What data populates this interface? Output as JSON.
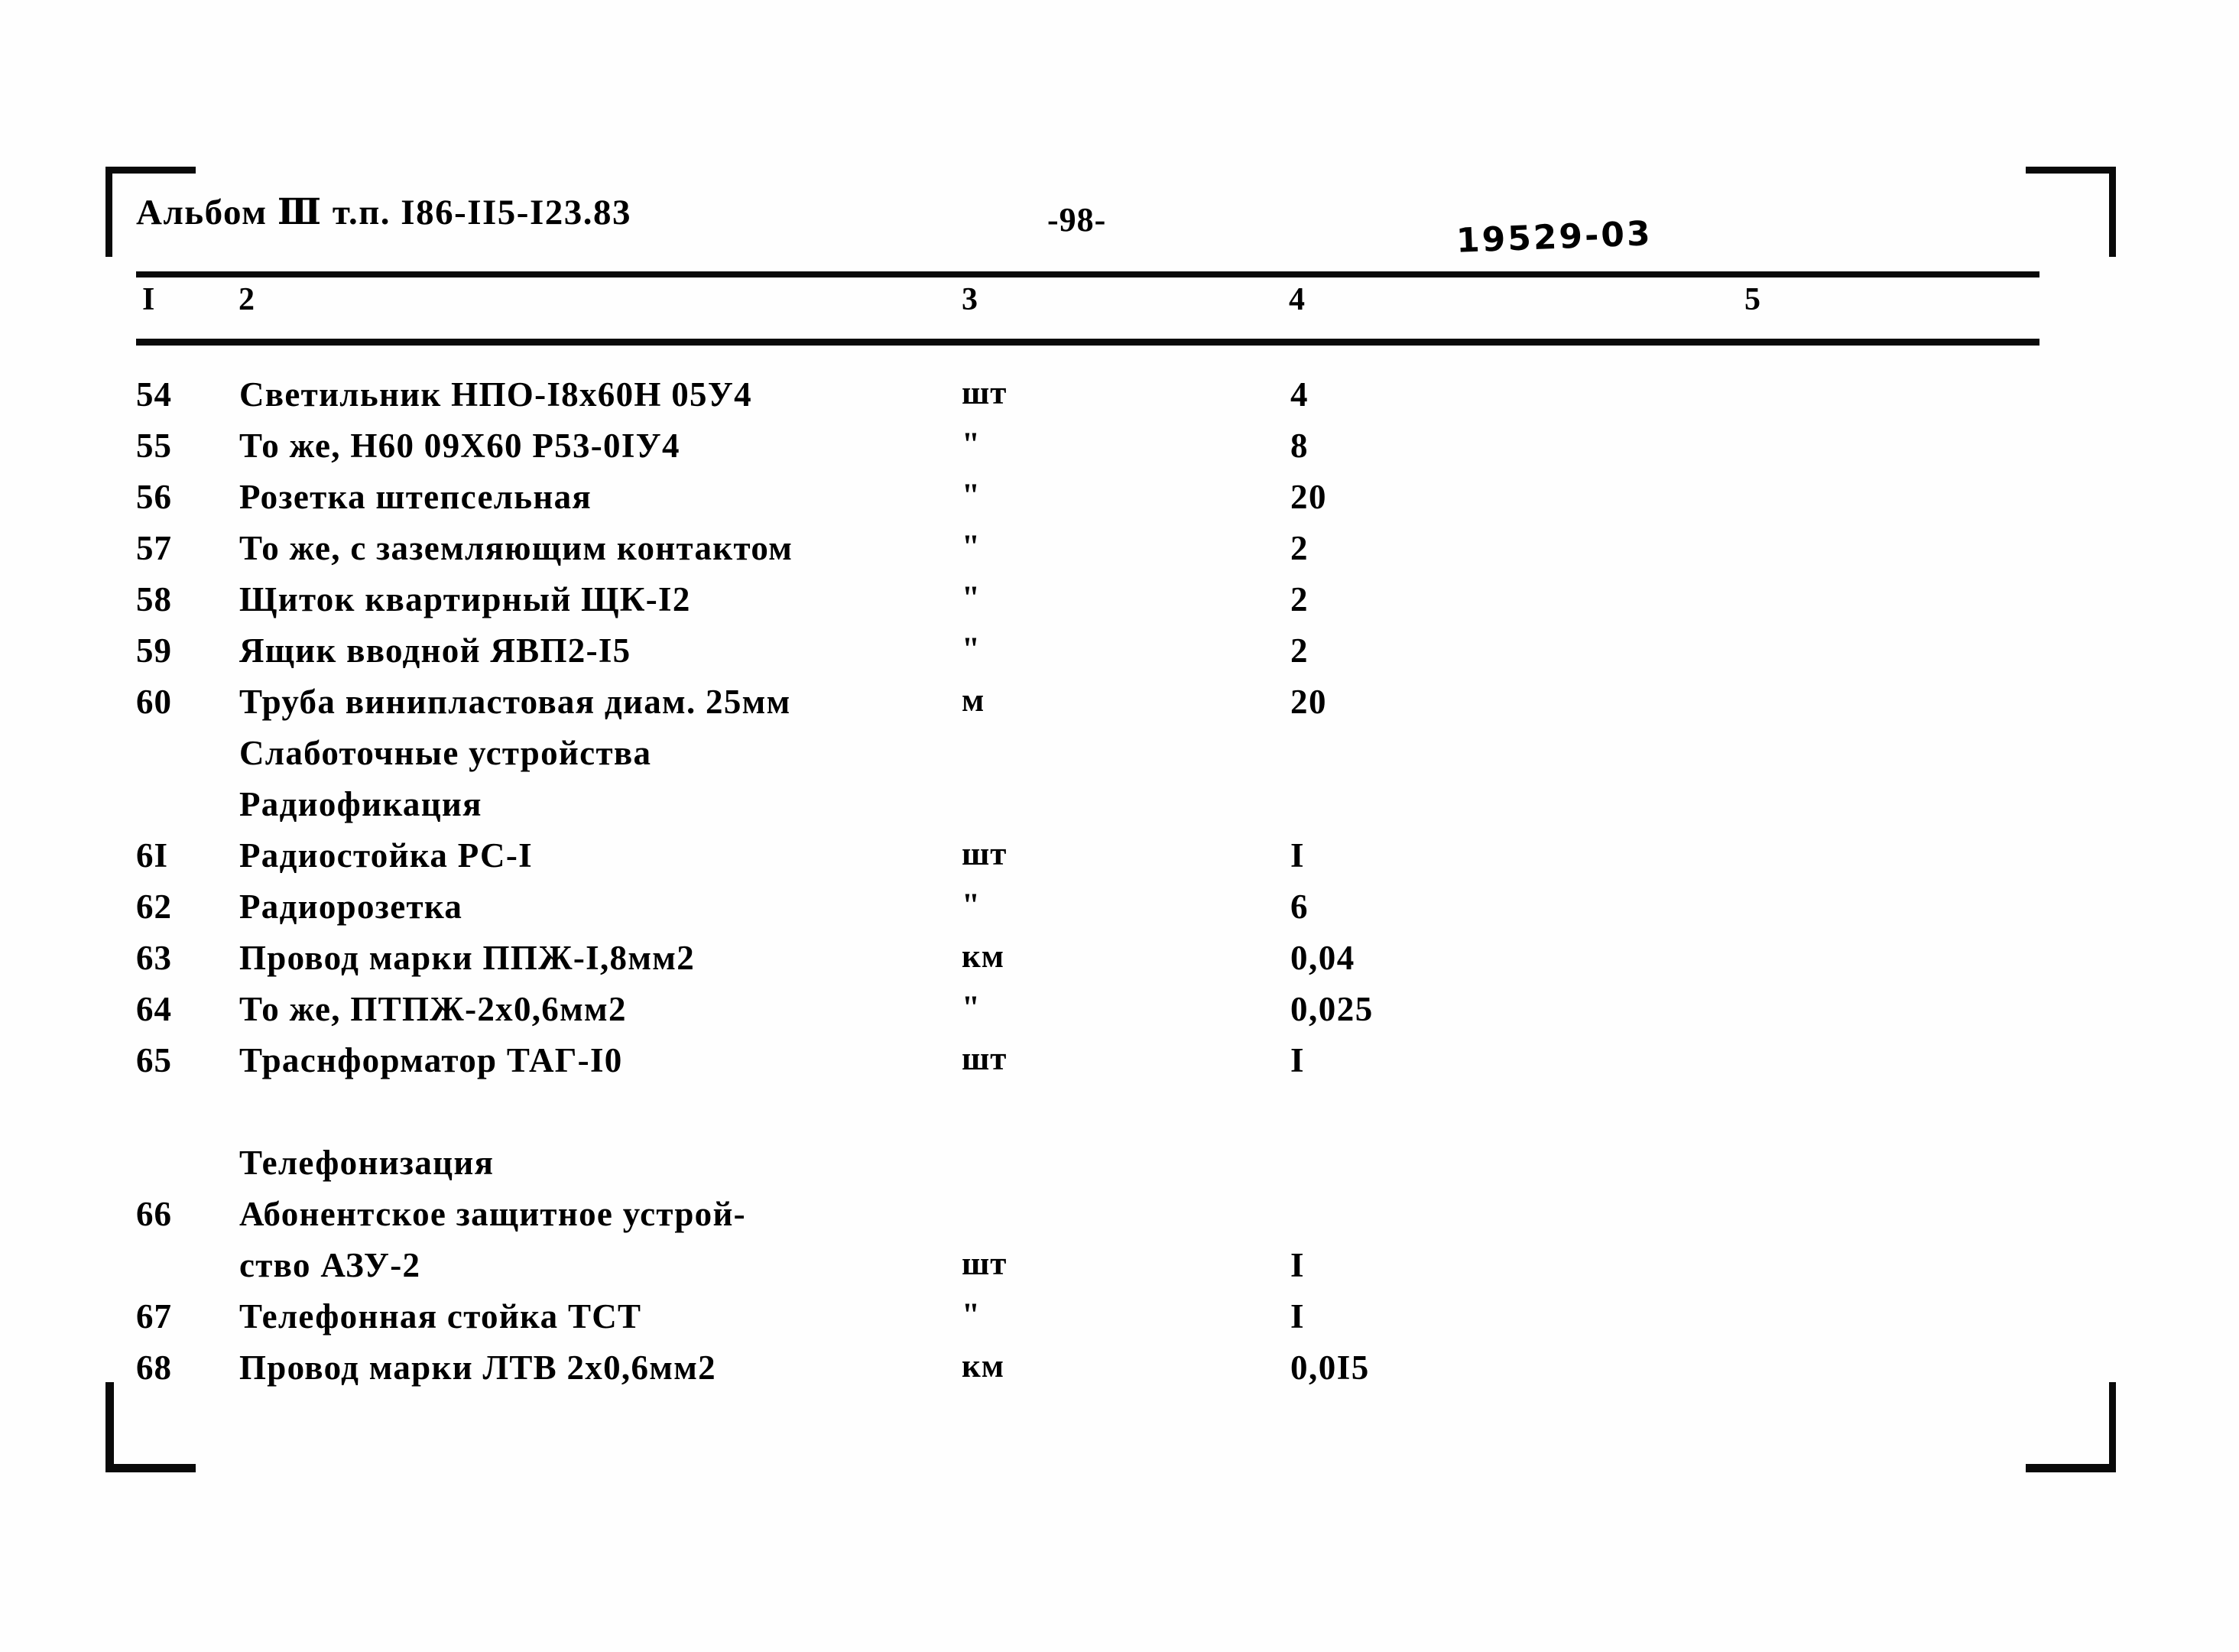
{
  "header": {
    "album_title": "Альбом Ⅲ т.п. I86-II5-I23.83",
    "page_number": "-98-",
    "doc_stamp": "19529-03"
  },
  "table": {
    "column_numbers": [
      "I",
      "2",
      "3",
      "4",
      "5"
    ],
    "rows": [
      {
        "no": "54",
        "name": "Светильник НПО-I8х60Н 05У4",
        "unit": "шт",
        "qty": "4",
        "note": ""
      },
      {
        "no": "55",
        "name": "То же, Н60 09Х60 Р53-0IУ4",
        "unit": "\"",
        "qty": "8",
        "note": ""
      },
      {
        "no": "56",
        "name": "Розетка штепсельная",
        "unit": "\"",
        "qty": "20",
        "note": ""
      },
      {
        "no": "57",
        "name": "То же, с заземляющим  контактом",
        "unit": "\"",
        "qty": "2",
        "note": ""
      },
      {
        "no": "58",
        "name": "Щиток квартирный ЩК-I2",
        "unit": "\"",
        "qty": "2",
        "note": ""
      },
      {
        "no": "59",
        "name": "Ящик вводной ЯВП2-I5",
        "unit": "\"",
        "qty": "2",
        "note": ""
      },
      {
        "no": "60",
        "name": "Труба винипластовая диам. 25мм",
        "unit": "м",
        "qty": "20",
        "note": ""
      },
      {
        "no": "",
        "name": "Слаботочные устройства",
        "unit": "",
        "qty": "",
        "note": "",
        "kind": "section"
      },
      {
        "no": "",
        "name": "Радиофикация",
        "unit": "",
        "qty": "",
        "note": "",
        "kind": "section"
      },
      {
        "no": "6I",
        "name": "Радиостойка РС-I",
        "unit": "шт",
        "qty": "I",
        "note": ""
      },
      {
        "no": "62",
        "name": "Радиорозетка",
        "unit": "\"",
        "qty": "6",
        "note": ""
      },
      {
        "no": "63",
        "name": "Провод марки ППЖ-I,8мм2",
        "unit": "км",
        "qty": "0,04",
        "note": ""
      },
      {
        "no": "64",
        "name": "То же, ПТПЖ-2х0,6мм2",
        "unit": "\"",
        "qty": "0,025",
        "note": ""
      },
      {
        "no": "65",
        "name": "Траснформатор ТАГ-I0",
        "unit": "шт",
        "qty": "I",
        "note": ""
      },
      {
        "no": "",
        "name": "",
        "unit": "",
        "qty": "",
        "note": "",
        "kind": "spacer"
      },
      {
        "no": "",
        "name": "Телефонизация",
        "unit": "",
        "qty": "",
        "note": "",
        "kind": "section"
      },
      {
        "no": "66",
        "name": "Абонентское защитное устрой-",
        "unit": "",
        "qty": "",
        "note": ""
      },
      {
        "no": "",
        "name": "ство АЗУ-2",
        "unit": "шт",
        "qty": "I",
        "note": "",
        "kind": "cont"
      },
      {
        "no": "67",
        "name": "Телефонная стойка ТСТ",
        "unit": "\"",
        "qty": "I",
        "note": ""
      },
      {
        "no": "68",
        "name": "Провод марки ЛТВ 2х0,6мм2",
        "unit": "км",
        "qty": "0,0I5",
        "note": ""
      }
    ]
  }
}
